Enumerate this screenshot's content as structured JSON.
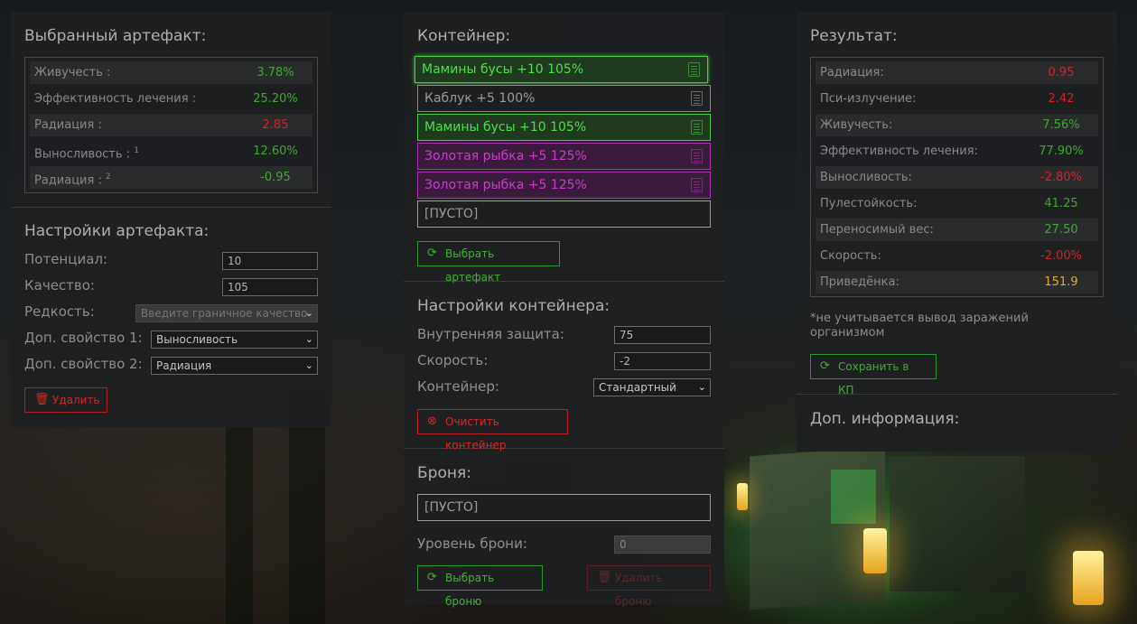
{
  "selected_artifact": {
    "title": "Выбранный артефакт:",
    "stats": [
      {
        "label": "Живучесть :",
        "value": "3.78%",
        "color": "green"
      },
      {
        "label": "Эффективность лечения :",
        "value": "25.20%",
        "color": "green"
      },
      {
        "label": "Радиация :",
        "value": "2.85",
        "color": "red"
      },
      {
        "label": "Выносливость :",
        "sup": "1",
        "value": "12.60%",
        "color": "green"
      },
      {
        "label": "Радиация :",
        "sup": "2",
        "value": "-0.95",
        "color": "green"
      }
    ]
  },
  "artifact_settings": {
    "title": "Настройки артефакта:",
    "potential_label": "Потенциал:",
    "potential_value": "10",
    "quality_label": "Качество:",
    "quality_value": "105",
    "rarity_label": "Редкость:",
    "rarity_value": "Введите граничное качество",
    "extra1_label": "Доп. свойство 1:",
    "extra1_value": "Выносливость",
    "extra2_label": "Доп. свойство 2:",
    "extra2_value": "Радиация",
    "delete_label": "Удалить"
  },
  "container": {
    "title": "Контейнер:",
    "slots": [
      {
        "label": "Мамины бусы +10 105%",
        "kind": "green"
      },
      {
        "label": "Каблук +5 100%",
        "kind": "grey"
      },
      {
        "label": "Мамины бусы +10 105%",
        "kind": "green"
      },
      {
        "label": "Золотая рыбка +5 125%",
        "kind": "purple"
      },
      {
        "label": "Золотая рыбка +5 125%",
        "kind": "purple"
      },
      {
        "label": "[ПУСТО]",
        "kind": "empty"
      }
    ],
    "select_artifact_label": "Выбрать артефакт"
  },
  "container_settings": {
    "title": "Настройки контейнера:",
    "inner_protection_label": "Внутренняя защита:",
    "inner_protection_value": "75",
    "speed_label": "Скорость:",
    "speed_value": "-2",
    "container_label": "Контейнер:",
    "container_value": "Стандартный",
    "clear_label": "Очистить контейнер"
  },
  "armor": {
    "title": "Броня:",
    "slot_label": "[ПУСТО]",
    "level_label": "Уровень брони:",
    "level_value": "0",
    "select_label": "Выбрать броню",
    "delete_label": "Удалить броню"
  },
  "result": {
    "title": "Результат:",
    "stats": [
      {
        "label": "Радиация:",
        "value": "0.95",
        "color": "red"
      },
      {
        "label": "Пси-излучение:",
        "value": "2.42",
        "color": "red"
      },
      {
        "label": "Живучесть:",
        "value": "7.56%",
        "color": "green"
      },
      {
        "label": "Эффективность лечения:",
        "value": "77.90%",
        "color": "green"
      },
      {
        "label": "Выносливость:",
        "value": "-2.80%",
        "color": "red"
      },
      {
        "label": "Пулестойкость:",
        "value": "41.25",
        "color": "green"
      },
      {
        "label": "Переносимый вес:",
        "value": "27.50",
        "color": "green"
      },
      {
        "label": "Скорость:",
        "value": "-2.00%",
        "color": "red"
      },
      {
        "label": "Приведёнка:",
        "value": "151.9",
        "color": "yellow"
      }
    ],
    "note": "*не учитывается вывод заражений организмом",
    "save_label": "Сохранить в КП"
  },
  "extra_info": {
    "title": "Доп. информация:"
  },
  "colors": {
    "green": "#3fae2f",
    "red": "#d8262a",
    "yellow": "#e1b23a",
    "panel": "#1f2022"
  }
}
